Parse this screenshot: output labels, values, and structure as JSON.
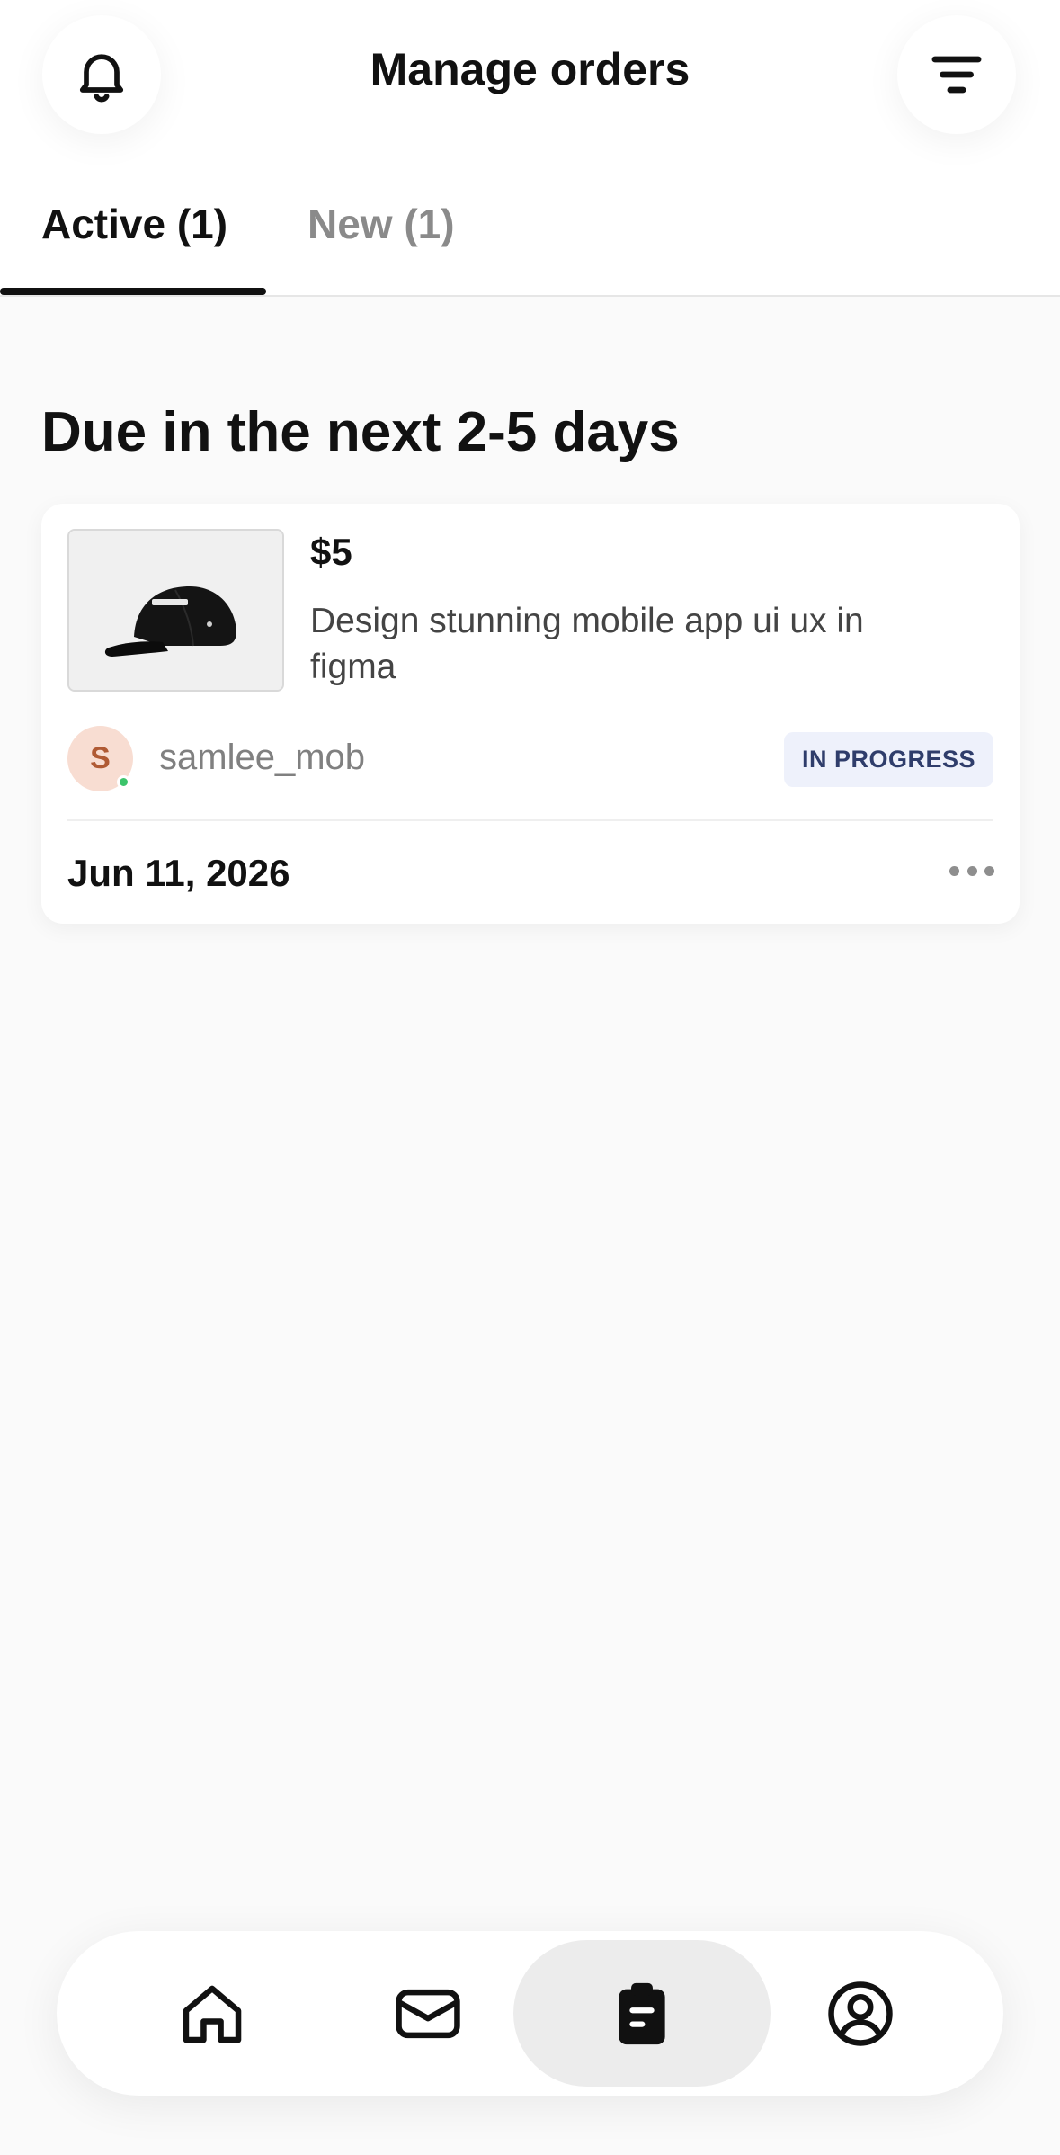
{
  "header": {
    "title": "Manage orders",
    "left_icon": "bell-icon",
    "right_icon": "filter-icon"
  },
  "tabs": [
    {
      "label": "Active (1)",
      "active": true
    },
    {
      "label": "New (1)",
      "active": false
    }
  ],
  "section": {
    "title": "Due in the next 2-5 days"
  },
  "order": {
    "image_icon": "cap-product-image",
    "price": "$5",
    "description": "Design stunning mobile app ui ux in figma",
    "buyer": {
      "initial": "S",
      "username": "samlee_mob",
      "online": true
    },
    "status": "IN PROGRESS",
    "due_date": "Jun 11, 2026",
    "more_icon": "more-dots-icon"
  },
  "bottom_nav": [
    {
      "icon": "home-icon",
      "selected": false
    },
    {
      "icon": "mail-icon",
      "selected": false
    },
    {
      "icon": "clipboard-icon",
      "selected": true
    },
    {
      "icon": "profile-icon",
      "selected": false
    }
  ],
  "colors": {
    "background": "#fafafa",
    "text": "#111111",
    "muted": "#8a8a8a",
    "badge_bg": "#eef1fb",
    "badge_text": "#2f3d6b",
    "avatar_bg": "#f8ddd2",
    "online": "#3cc46b"
  }
}
